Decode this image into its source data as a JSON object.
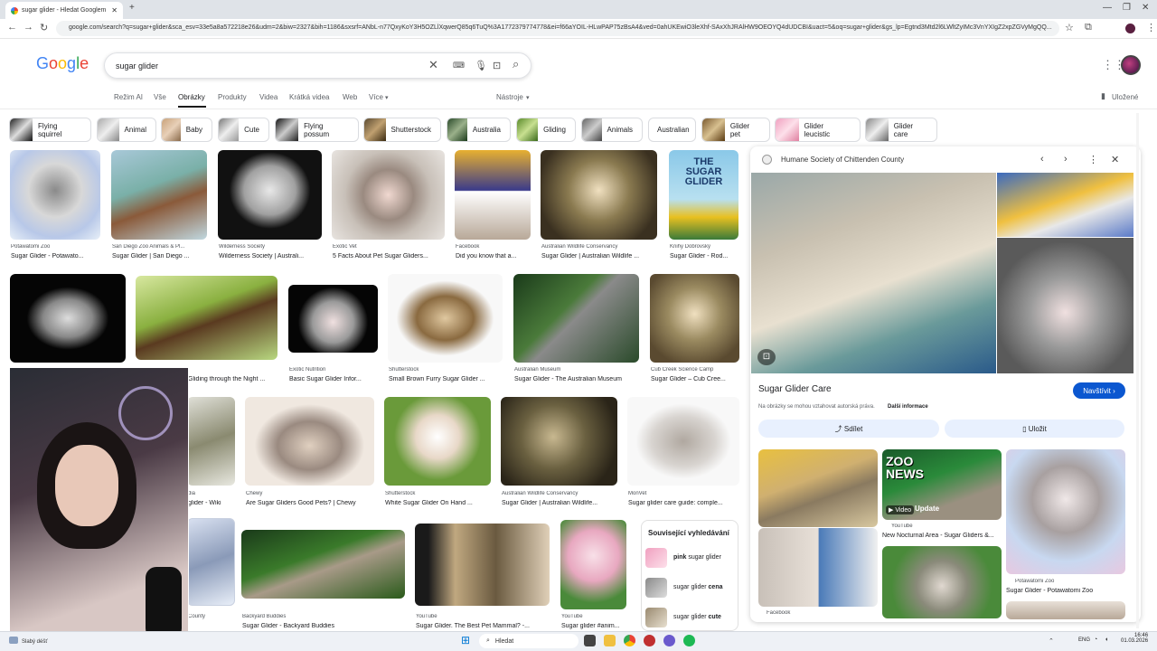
{
  "browser": {
    "tab_title": "sugar glider - Hledat Googlem",
    "new_tab": "+",
    "url": "google.com/search?q=sugar+glider&sca_esv=33e5a8a572218e26&udm=2&biw=2327&bih=1186&sxsrf=ANbL-n77QxyKoY3H5OZLlXqwerQ85q6TuQ%3A1772379774778&ei=f66aYOIL-HLwPAP75zBsA4&ved=0ahUKEwiO3leXhf-SAxXhJRAlHW9OEOYQ4dUDCBI&uact=5&oq=sugar+glider&gs_lp=Egtnd3Mtd2l6LWltZyIMc3VnYXIgZ2xpZGVyMgQQ..."
  },
  "google": {
    "logo_letters": [
      "G",
      "o",
      "o",
      "g",
      "l",
      "e"
    ],
    "search_value": "sugar glider"
  },
  "nav": {
    "items": [
      "Režim AI",
      "Vše",
      "Obrázky",
      "Produkty",
      "Videa",
      "Krátká videa",
      "Web",
      "Více"
    ],
    "more_arrow": "▾",
    "tools": "Nástroje",
    "tools_arrow": "▾",
    "saved": "Uložené"
  },
  "chips": [
    "Flying squirrel",
    "Animal",
    "Baby",
    "Cute",
    "Flying possum",
    "Shutterstock",
    "Australia",
    "Gliding",
    "Animals",
    "Australian",
    "Glider pet",
    "Glider leucistic",
    "Glider care"
  ],
  "results_row1": [
    {
      "src": "Potawatomi Zoo",
      "title": "Sugar Glider - Potawato..."
    },
    {
      "src": "San Diego Zoo Animals & Pl...",
      "title": "Sugar Glider | San Diego ..."
    },
    {
      "src": "Wilderness Society",
      "title": "Wilderness Society | Australi..."
    },
    {
      "src": "Exotic Vet",
      "title": "5 Facts About Pet Sugar Gliders..."
    },
    {
      "src": "Facebook",
      "title": "Did you know that a..."
    },
    {
      "src": "Australian Wildlife Conservancy",
      "title": "Sugar Glider | Australian Wildlife ..."
    },
    {
      "src": "Knihy Dobrovský",
      "title": "Sugar Glider - Rod..."
    }
  ],
  "results_row2": [
    {
      "src": "",
      "title": "Gliding through the Night ..."
    },
    {
      "src": "Exotic Nutrition",
      "title": "Basic Sugar Glider Infor..."
    },
    {
      "src": "Shutterstock",
      "title": "Small Brown Furry Sugar Glider ..."
    },
    {
      "src": "Australian Museum",
      "title": "Sugar Glider - The Australian Museum"
    },
    {
      "src": "Cub Creek Science Camp",
      "title": "Sugar Glider – Cub Cree..."
    }
  ],
  "results_row3": [
    {
      "src": "dia",
      "title": "glider - Wiki"
    },
    {
      "src": "Chewy",
      "title": "Are Sugar Gliders Good Pets? | Chewy"
    },
    {
      "src": "Shutterstock",
      "title": "White Sugar Glider On Hand ..."
    },
    {
      "src": "Australian Wildlife Conservancy",
      "title": "Sugar Glider | Australian Wildlife..."
    },
    {
      "src": "MonVet",
      "title": "Sugar glider care guide: comple..."
    }
  ],
  "results_row4": [
    {
      "src": "County",
      "title": ""
    },
    {
      "src": "Backyard Buddies",
      "title": "Sugar Glider - Backyard Buddies"
    },
    {
      "src": "YouTube",
      "title": "Sugar Glider. The Best Pet Mammal? -..."
    },
    {
      "src": "YouTube",
      "title": "Sugar glider #anim..."
    }
  ],
  "book_cover": {
    "line1": "THE",
    "line2": "SUGAR",
    "line3": "GLIDER"
  },
  "related": {
    "heading": "Související vyhledávání",
    "items": [
      {
        "bold": "pink",
        "rest": " sugar glider"
      },
      {
        "bold": "",
        "rest": "sugar glider ",
        "bold2": "cena"
      },
      {
        "bold": "",
        "rest": "sugar glider ",
        "bold2": "cute"
      }
    ]
  },
  "panel": {
    "source": "Humane Society of Chittenden County",
    "title": "Sugar Glider Care",
    "visit": "Navštívit",
    "visit_arrow": "›",
    "copyright": "Na obrázky se mohou vztahovat autorská práva.",
    "more_info": "Další informace",
    "share": "Sdílet",
    "save": "Uložit",
    "related": [
      {
        "src": "YouTube",
        "title": "New Nocturnal Area - Sugar Gliders &..."
      },
      {
        "src": "Potawatomi Zoo",
        "title": "Sugar Glider - Potawatomi Zoo"
      },
      {
        "src": "Facebook",
        "title": ""
      }
    ],
    "zoo_news": {
      "l1": "ZOO",
      "l2": "NEWS",
      "video": "Video",
      "update": "Update"
    }
  },
  "taskbar": {
    "search": "Hledat",
    "weather": "Slabý déšť",
    "lang": "ENG",
    "time": "16:46",
    "date": "01.03.2026"
  },
  "colors": {
    "google_blue": "#4285f4",
    "google_red": "#ea4335",
    "google_yellow": "#fbbc05",
    "google_green": "#34a853",
    "visit_button": "#0b57d0"
  }
}
